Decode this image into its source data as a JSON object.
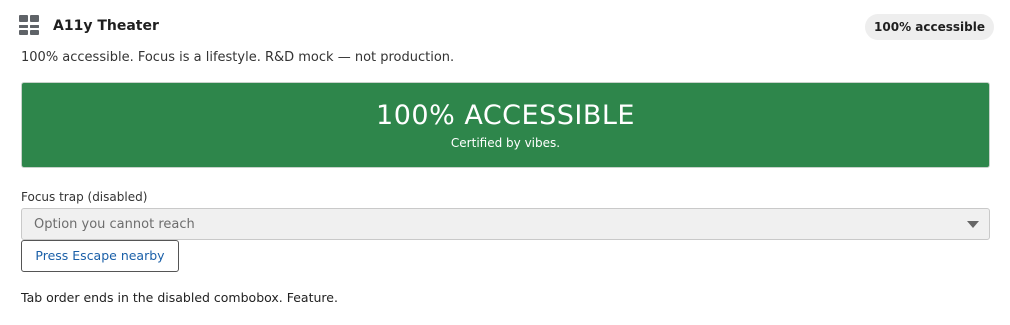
{
  "header": {
    "logo_icon": "grid-icon",
    "title": "A11y Theater",
    "badge": "100% accessible"
  },
  "subtitle": "100% accessible. Focus is a lifestyle. R&D mock — not production.",
  "banner": {
    "title": "100% ACCESSIBLE",
    "subtitle": "Certified by vibes.",
    "color": "#2e864b"
  },
  "focus_trap": {
    "label": "Focus trap (disabled)",
    "value": "Option you cannot reach",
    "disabled": true,
    "caret_icon": "chevron-down-icon"
  },
  "escape_button": {
    "label": "Press Escape nearby"
  },
  "footer_note": "Tab order ends in the disabled combobox. Feature."
}
